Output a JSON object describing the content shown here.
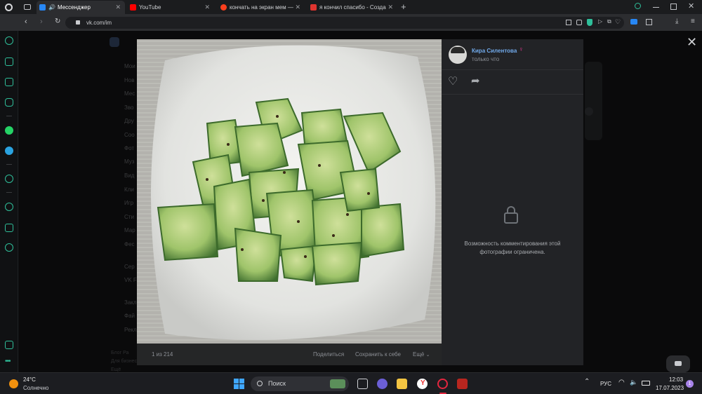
{
  "browser": {
    "tabs": [
      {
        "title": "Мессенджер",
        "favicon_color": "#2787f5"
      },
      {
        "title": "YouTube",
        "favicon_color": "#ff0000"
      },
      {
        "title": "кончать на экран мем —",
        "favicon_color": "#fc3f1d"
      },
      {
        "title": "я кончил спасибо - Созда",
        "favicon_color": "#e0342f"
      }
    ],
    "new_tab_label": "+",
    "url": "vk.com/im"
  },
  "vk_background": {
    "menu_items": [
      "Мои",
      "Нов",
      "Мес",
      "Зво",
      "Дру",
      "Соо",
      "Фот",
      "Муз",
      "Вид",
      "Кли",
      "Игр",
      "Сти",
      "Мар",
      "Фес",
      "Сер",
      "VK F",
      "Закл",
      "Фай",
      "Рекл"
    ],
    "footer": [
      "Блог Ра",
      "Для бизнес",
      "Ещё"
    ]
  },
  "photo_viewer": {
    "author_name": "Кира Силентова",
    "post_time": "только что",
    "comments_locked_text": "Возможность комментирования этой фотографии ограничена.",
    "counter": "1 из 214",
    "share_label": "Поделиться",
    "save_label": "Сохранить к себе",
    "more_label": "Ещё",
    "close_icon": "close-icon",
    "colors": {
      "accent": "#71aaeb",
      "panel": "#222326",
      "lock": "#6f7378"
    }
  },
  "taskbar": {
    "weather_temp": "24°C",
    "weather_desc": "Солнечно",
    "search_placeholder": "Поиск",
    "language": "РУС",
    "time": "12:03",
    "date": "17.07.2023",
    "notification_count": "1"
  }
}
